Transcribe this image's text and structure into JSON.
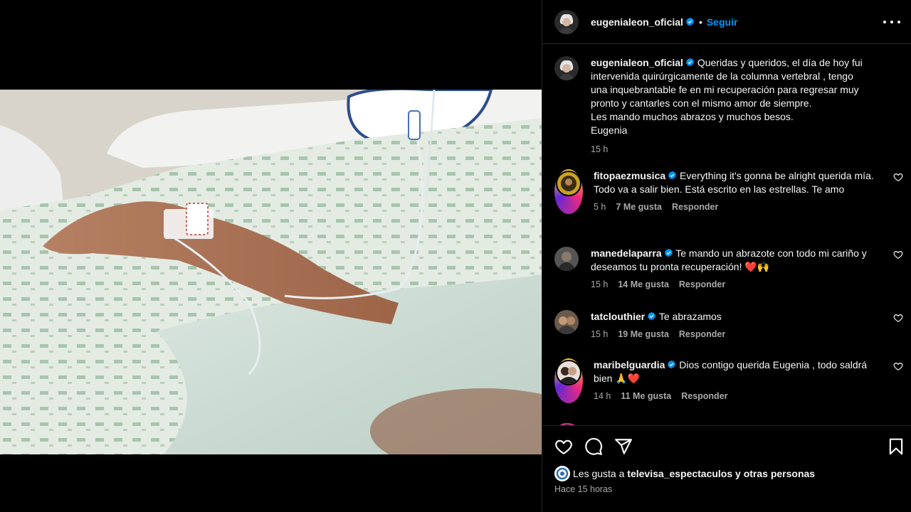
{
  "header": {
    "username": "eugenialeon_oficial",
    "separator": "•",
    "follow_label": "Seguir"
  },
  "caption": {
    "username": "eugenialeon_oficial",
    "text_line1": "Queridas y queridos, el día de hoy fui",
    "text_line2": "intervenida quirúrgicamente de la columna vertebral , tengo",
    "text_line3": "una inquebrantable fe en mi recuperación para regresar muy",
    "text_line4": "pronto y cantarles con el mismo amor de siempre.",
    "text_line5": "Les mando muchos abrazos y muchos besos.",
    "text_line6": "Eugenia",
    "time": "15 h"
  },
  "comments": [
    {
      "username": "fitopaezmusica",
      "text": "Everything it's gonna be alright querida mía. Todo va a salir bien. Está escrito en las estrellas. Te amo",
      "time": "5 h",
      "likes": "7 Me gusta",
      "reply": "Responder"
    },
    {
      "username": "manedelaparra",
      "text": "Te mando un abrazote con todo mi cariño y deseamos tu pronta recuperación! ❤️🙌",
      "time": "15 h",
      "likes": "14 Me gusta",
      "reply": "Responder"
    },
    {
      "username": "tatclouthier",
      "text": "Te abrazamos",
      "time": "15 h",
      "likes": "19 Me gusta",
      "reply": "Responder"
    },
    {
      "username": "maribelguardia",
      "text": "Dios contigo querida Eugenia , todo saldrá bien 🙏❤️",
      "time": "14 h",
      "likes": "11 Me gusta",
      "reply": "Responder"
    }
  ],
  "likes_line": {
    "prefix": "Les gusta a",
    "user": "televisa_espectaculos",
    "suffix": "y otras personas"
  },
  "posted": "Hace 15 horas",
  "icons": {
    "like": "heart-icon",
    "comment": "comment-icon",
    "share": "share-icon",
    "save": "bookmark-icon",
    "more": "more-icon",
    "verified": "verified-badge-icon"
  },
  "colors": {
    "accent": "#0095f6",
    "verified": "#0095f6",
    "secondary_text": "#a8a8a8"
  }
}
